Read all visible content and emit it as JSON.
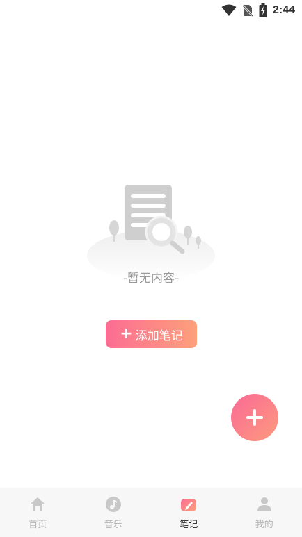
{
  "status_bar": {
    "time": "2:44"
  },
  "empty_state": {
    "message": "-暂无内容-",
    "illustration": "empty-document-search-icon"
  },
  "add_note": {
    "label": "添加笔记",
    "icon": "plus-icon"
  },
  "fab": {
    "icon": "plus-icon"
  },
  "bottom_nav": {
    "items": [
      {
        "label": "首页",
        "icon": "home-icon",
        "active": false
      },
      {
        "label": "音乐",
        "icon": "music-icon",
        "active": false
      },
      {
        "label": "笔记",
        "icon": "note-pen-icon",
        "active": true
      },
      {
        "label": "我的",
        "icon": "profile-icon",
        "active": false
      }
    ]
  },
  "colors": {
    "accent_start": "#fb6d93",
    "accent_end": "#fda07a",
    "nav_inactive": "#b5b5b5",
    "nav_active": "#222222"
  }
}
